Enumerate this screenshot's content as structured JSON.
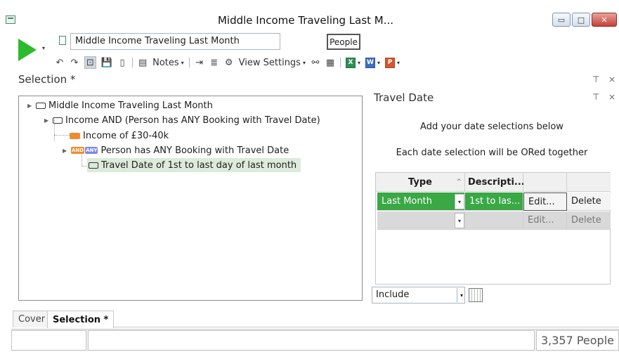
{
  "window": {
    "title": "Middle Income Traveling Last M...",
    "min_glyph": "▭",
    "max_glyph": "□",
    "close_glyph": "✕"
  },
  "toolbar": {
    "selection_name": "Middle Income Traveling Last Month",
    "people_label": "People",
    "notes_label": "Notes",
    "view_settings_label": "View Settings",
    "dropdown_glyph": "▾",
    "icons": {
      "undo": "↶",
      "redo": "↷",
      "lock": "⊡",
      "save": "💾",
      "page": "▯",
      "notes": "▤",
      "indent": "⇥",
      "outdent": "≣",
      "settings": "⚙",
      "network": "⚯",
      "grid": "▦",
      "excel": "X",
      "word": "W",
      "powerpoint": "P"
    }
  },
  "selection_header": "Selection *",
  "tree": {
    "nodes": [
      {
        "label": "Middle Income Traveling Last Month"
      },
      {
        "label": "Income AND (Person has ANY Booking with Travel Date)"
      },
      {
        "label": "Income of £30-40k"
      },
      {
        "label": "Person has ANY Booking with Travel Date"
      },
      {
        "label": "Travel Date of 1st to last day of last month"
      }
    ],
    "and_badge": "AND",
    "any_badge": "ANY"
  },
  "panel": {
    "title": "Travel Date",
    "pin_glyph": "⊤",
    "close_glyph": "×",
    "info_line1": "Add your date selections below",
    "info_line2": "Each date selection will be ORed together",
    "grid": {
      "headers": [
        "Type",
        "Descripti...",
        "",
        ""
      ],
      "sort_glyph": "^",
      "rows": [
        {
          "type": "Last Month",
          "description": "1st to las...",
          "edit": "Edit...",
          "delete": "Delete"
        },
        {
          "type": "",
          "description": "",
          "edit": "Edit...",
          "delete": "Delete"
        }
      ]
    },
    "include_value": "Include"
  },
  "tabs": {
    "cover": "Cover",
    "selection": "Selection *"
  },
  "status": {
    "count": "3,357 People"
  },
  "colors": {
    "run_green": "#2dbb2d",
    "row_green": "#39a845",
    "orange": "#f28a2e",
    "highlight": "#dcebdc"
  }
}
